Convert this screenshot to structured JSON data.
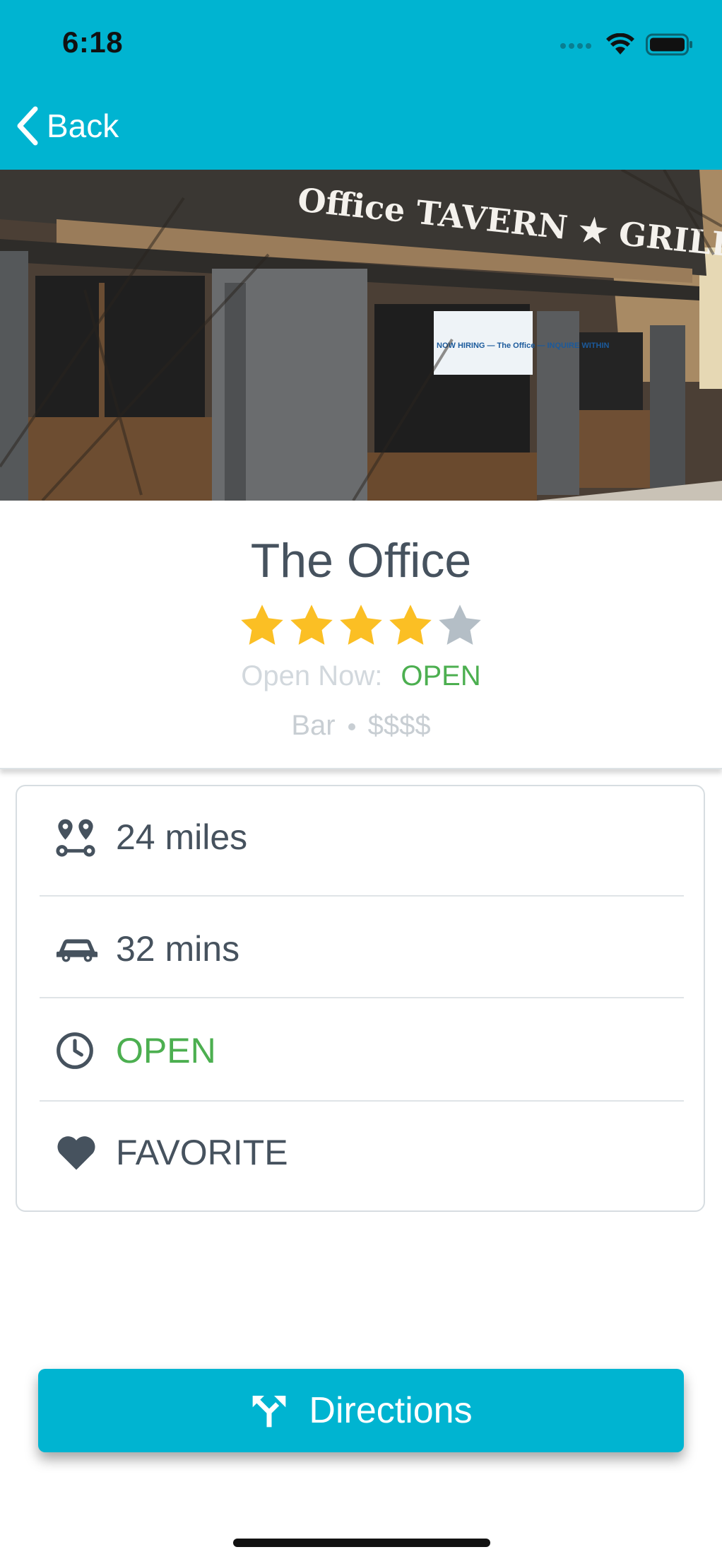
{
  "status_bar": {
    "time": "6:18"
  },
  "nav": {
    "back_label": "Back"
  },
  "venue": {
    "name": "The Office",
    "rating": 4,
    "rating_max": 5,
    "open_now_label": "Open Now:",
    "open_now_value": "OPEN",
    "category": "Bar",
    "price": "$$$$",
    "hero_sign_text": "Office TAVERN ★ GRILL",
    "hero_banner_text": "NOW HIRING — The Office — INQUIRE WITHIN"
  },
  "details": [
    {
      "icon": "map-pins-icon",
      "label": "24 miles"
    },
    {
      "icon": "car-icon",
      "label": "32 mins"
    },
    {
      "icon": "clock-icon",
      "label": "OPEN"
    },
    {
      "icon": "heart-icon",
      "label": "FAVORITE"
    }
  ],
  "directions": {
    "label": "Directions",
    "icon": "turn-fork-icon"
  },
  "colors": {
    "accent": "#00b4d1",
    "open_green": "#4caf50",
    "star_filled": "#fbbf24",
    "star_empty": "#b4bec6",
    "text_primary": "#46525e"
  }
}
